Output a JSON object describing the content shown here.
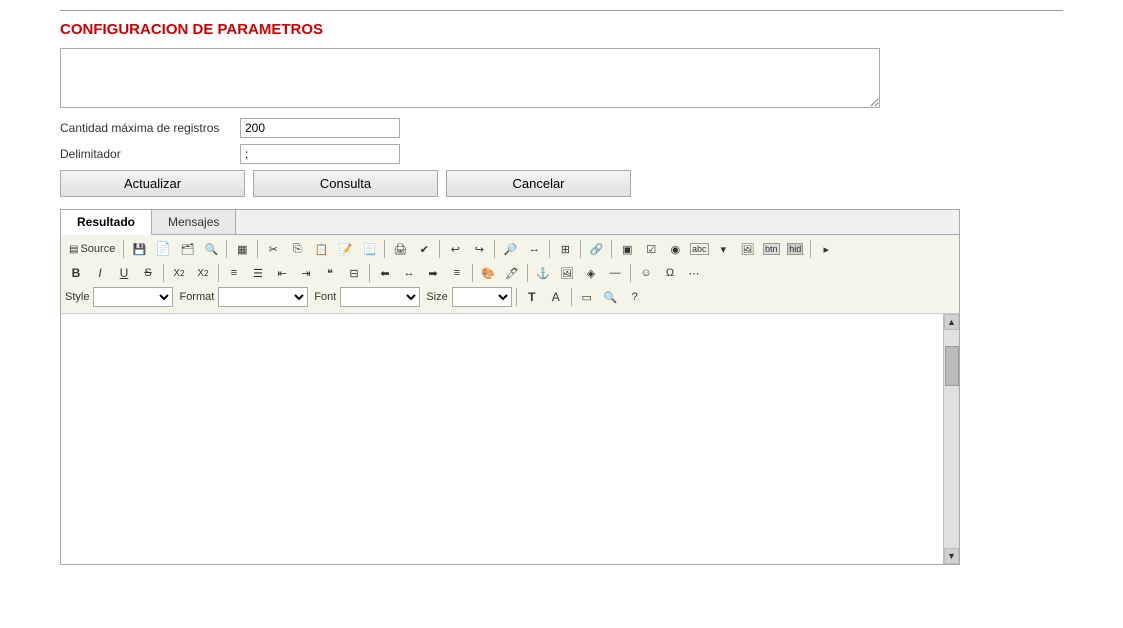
{
  "page": {
    "title": "CONFIGURACION DE PARAMETROS",
    "top_textarea_placeholder": ""
  },
  "form": {
    "max_records_label": "Cantidad máxima de registros",
    "max_records_value": "200",
    "delimiter_label": "Delimitador",
    "delimiter_value": ";"
  },
  "buttons": {
    "actualizar": "Actualizar",
    "consulta": "Consulta",
    "cancelar": "Cancelar"
  },
  "tabs": [
    {
      "id": "resultado",
      "label": "Resultado",
      "active": true
    },
    {
      "id": "mensajes",
      "label": "Mensajes",
      "active": false
    }
  ],
  "toolbar": {
    "row1": [
      {
        "id": "source",
        "label": "Source",
        "type": "text-btn"
      },
      {
        "id": "save",
        "icon": "💾",
        "title": "Save"
      },
      {
        "id": "new-doc",
        "icon": "📄",
        "title": "New Document"
      },
      {
        "id": "open",
        "icon": "📁",
        "title": "Open"
      },
      {
        "id": "preview",
        "icon": "🔍",
        "title": "Preview"
      },
      {
        "id": "templates",
        "icon": "▦",
        "title": "Templates"
      },
      {
        "id": "cut",
        "icon": "✂",
        "title": "Cut"
      },
      {
        "id": "copy",
        "icon": "📋",
        "title": "Copy"
      },
      {
        "id": "paste",
        "icon": "📌",
        "title": "Paste"
      },
      {
        "id": "paste-text",
        "icon": "📝",
        "title": "Paste as Text"
      },
      {
        "id": "paste-word",
        "icon": "📃",
        "title": "Paste from Word"
      },
      {
        "id": "print",
        "icon": "🖨",
        "title": "Print"
      },
      {
        "id": "spellcheck",
        "icon": "🔤",
        "title": "Spellcheck"
      },
      {
        "id": "undo",
        "icon": "↩",
        "title": "Undo"
      },
      {
        "id": "redo",
        "icon": "↪",
        "title": "Redo"
      },
      {
        "id": "find",
        "icon": "🔎",
        "title": "Find"
      },
      {
        "id": "replace",
        "icon": "↔",
        "title": "Replace"
      },
      {
        "id": "table",
        "icon": "⊞",
        "title": "Table"
      },
      {
        "id": "link",
        "icon": "🔗",
        "title": "Link"
      },
      {
        "id": "form",
        "icon": "📋",
        "title": "Form"
      },
      {
        "id": "checkbox",
        "icon": "☑",
        "title": "Checkbox"
      },
      {
        "id": "radio",
        "icon": "◉",
        "title": "Radio"
      },
      {
        "id": "textfield",
        "icon": "▭",
        "title": "TextField"
      },
      {
        "id": "select-field",
        "icon": "▾",
        "title": "Select"
      },
      {
        "id": "image-field",
        "icon": "🖼",
        "title": "Image"
      },
      {
        "id": "btn-field",
        "icon": "▣",
        "title": "Button"
      },
      {
        "id": "hidden",
        "icon": "👁",
        "title": "Hidden"
      },
      {
        "id": "more1",
        "icon": "▸",
        "title": "More"
      }
    ],
    "row2": [
      {
        "id": "bold",
        "label": "B",
        "class": "icon-bold",
        "title": "Bold"
      },
      {
        "id": "italic",
        "label": "I",
        "class": "icon-italic",
        "title": "Italic"
      },
      {
        "id": "underline",
        "label": "U",
        "class": "icon-underline",
        "title": "Underline"
      },
      {
        "id": "strike",
        "label": "S̶",
        "class": "icon-strike",
        "title": "Strikethrough"
      },
      {
        "id": "sub",
        "label": "X₂",
        "title": "Subscript"
      },
      {
        "id": "sup",
        "label": "X²",
        "title": "Superscript"
      },
      {
        "id": "ol",
        "icon": "≡",
        "title": "Ordered List"
      },
      {
        "id": "ul",
        "icon": "☰",
        "title": "Unordered List"
      },
      {
        "id": "indent-less",
        "icon": "◁◁",
        "title": "Decrease Indent"
      },
      {
        "id": "indent-more",
        "icon": "▷▷",
        "title": "Increase Indent"
      },
      {
        "id": "blockquote",
        "icon": "❝",
        "title": "Blockquote"
      },
      {
        "id": "div",
        "icon": "⊟",
        "title": "Div"
      },
      {
        "id": "align-left",
        "icon": "⬅",
        "title": "Align Left"
      },
      {
        "id": "align-center",
        "icon": "↔",
        "title": "Align Center"
      },
      {
        "id": "align-right",
        "icon": "➡",
        "title": "Align Right"
      },
      {
        "id": "align-justify",
        "icon": "≡",
        "title": "Justify"
      },
      {
        "id": "text-color",
        "icon": "A",
        "title": "Text Color"
      },
      {
        "id": "bg-color",
        "icon": "🖊",
        "title": "Background Color"
      },
      {
        "id": "anchor",
        "icon": "⚓",
        "title": "Anchor"
      },
      {
        "id": "image",
        "icon": "🖼",
        "title": "Image"
      },
      {
        "id": "flash",
        "icon": "◈",
        "title": "Flash"
      },
      {
        "id": "hr",
        "icon": "—",
        "title": "Horizontal Rule"
      },
      {
        "id": "smiley",
        "icon": "☺",
        "title": "Smiley"
      },
      {
        "id": "special-char",
        "icon": "Ω",
        "title": "Special Character"
      },
      {
        "id": "page-break",
        "icon": "⋯",
        "title": "Page Break"
      }
    ],
    "row3": {
      "style_label": "Style",
      "style_value": "",
      "format_label": "Format",
      "format_value": "",
      "font_label": "Font",
      "font_value": "",
      "size_label": "Size",
      "size_value": "",
      "extra_btns": [
        "T",
        "A",
        "▭",
        "🔍",
        "?"
      ]
    }
  }
}
